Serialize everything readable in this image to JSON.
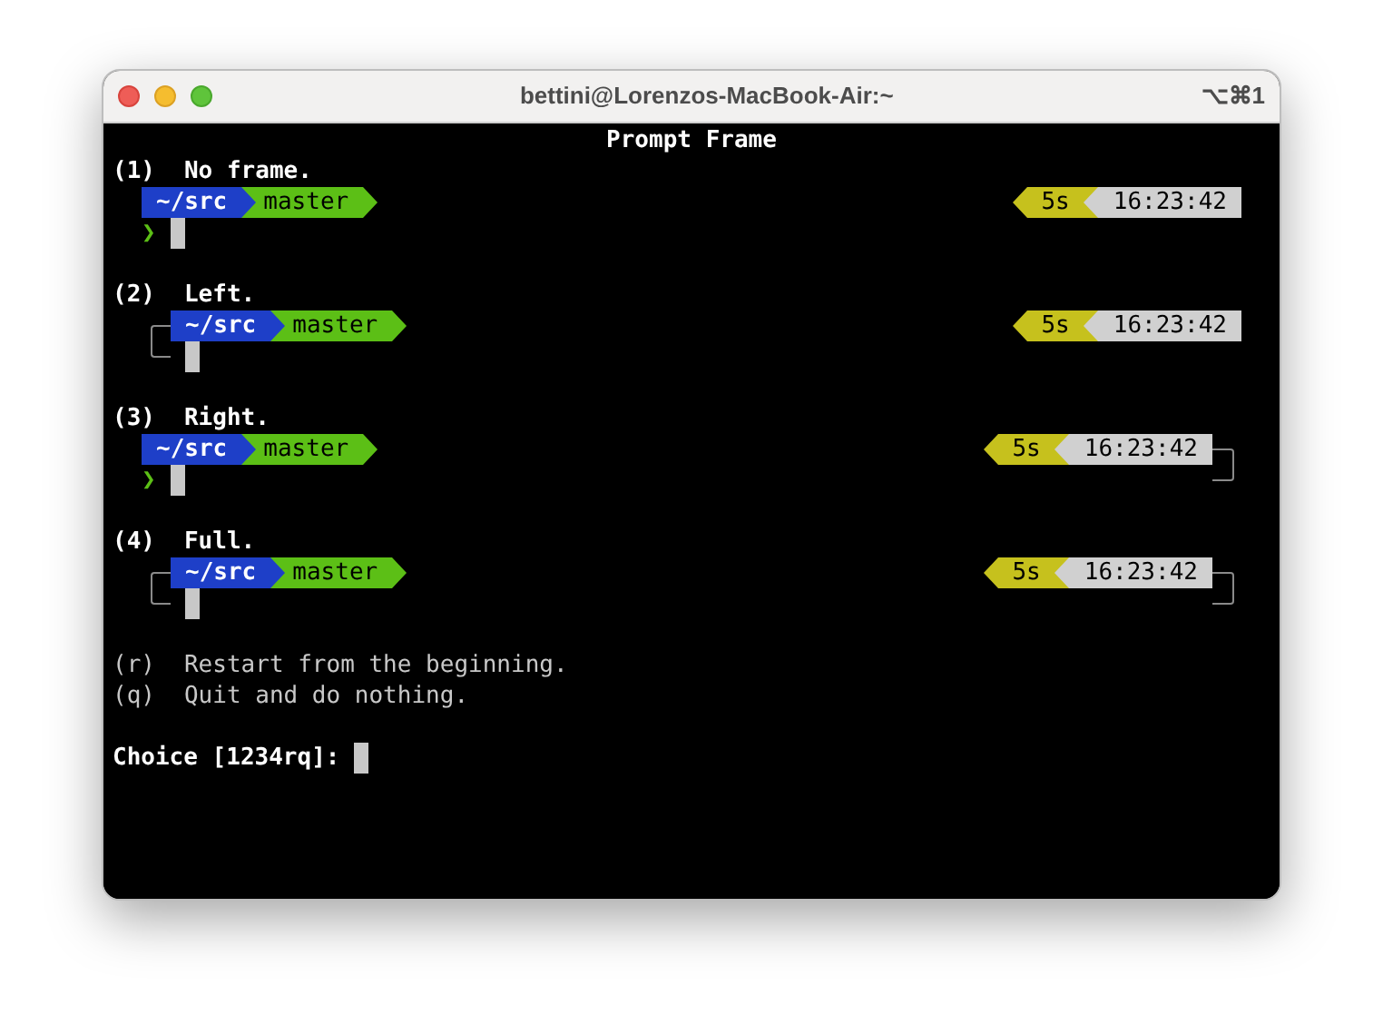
{
  "window": {
    "title": "bettini@Lorenzos-MacBook-Air:~",
    "shortcut": "⌥⌘1"
  },
  "heading": "Prompt Frame",
  "options": [
    {
      "key": "(1)",
      "label": "No frame.",
      "left_frame": false,
      "right_frame": false,
      "path": "~/src",
      "branch": "master",
      "duration": "5s",
      "time": "16:23:42",
      "prompt_symbol": "❯"
    },
    {
      "key": "(2)",
      "label": "Left.",
      "left_frame": true,
      "right_frame": false,
      "path": "~/src",
      "branch": "master",
      "duration": "5s",
      "time": "16:23:42"
    },
    {
      "key": "(3)",
      "label": "Right.",
      "left_frame": false,
      "right_frame": true,
      "path": "~/src",
      "branch": "master",
      "duration": "5s",
      "time": "16:23:42",
      "prompt_symbol": "❯"
    },
    {
      "key": "(4)",
      "label": "Full.",
      "left_frame": true,
      "right_frame": true,
      "path": "~/src",
      "branch": "master",
      "duration": "5s",
      "time": "16:23:42"
    }
  ],
  "commands": [
    {
      "key": "(r)",
      "label": "Restart from the beginning."
    },
    {
      "key": "(q)",
      "label": "Quit and do nothing."
    }
  ],
  "input": {
    "label": "Choice [1234rq]:"
  }
}
